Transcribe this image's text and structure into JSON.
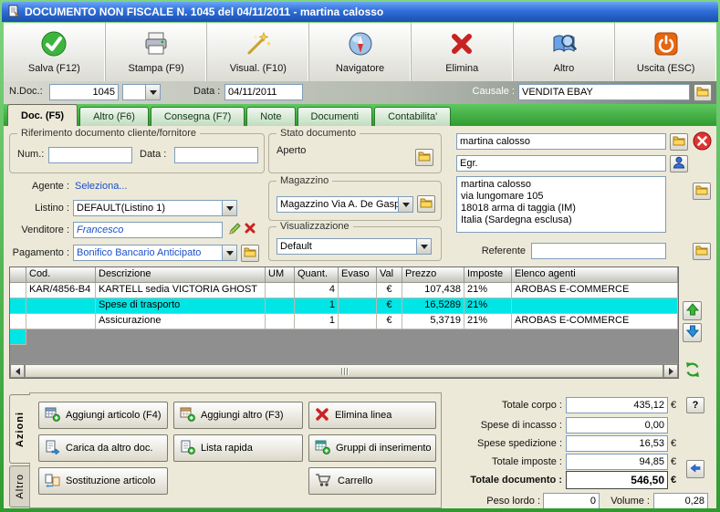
{
  "window": {
    "title": "DOCUMENTO NON FISCALE N. 1045  del 04/11/2011 - martina calosso"
  },
  "toolbar": {
    "buttons": [
      {
        "label": "Salva (F12)"
      },
      {
        "label": "Stampa (F9)"
      },
      {
        "label": "Visual. (F10)"
      },
      {
        "label": "Navigatore"
      },
      {
        "label": "Elimina"
      },
      {
        "label": "Altro"
      },
      {
        "label": "Uscita (ESC)"
      }
    ]
  },
  "header": {
    "ndoc_label": "N.Doc.:",
    "ndoc_value": "1045",
    "data_label": "Data :",
    "data_value": "04/11/2011",
    "causale_label": "Causale :",
    "causale_value": "VENDITA EBAY"
  },
  "tabs": [
    {
      "label": "Doc. (F5)"
    },
    {
      "label": "Altro (F6)"
    },
    {
      "label": "Consegna (F7)"
    },
    {
      "label": "Note"
    },
    {
      "label": "Documenti"
    },
    {
      "label": "Contabilita'"
    }
  ],
  "reference_box": {
    "legend": "Riferimento documento cliente/fornitore",
    "num_label": "Num.:",
    "num_value": "",
    "data_label": "Data :",
    "data_value": ""
  },
  "left_fields": {
    "agente_label": "Agente :",
    "agente_value": "Seleziona...",
    "listino_label": "Listino :",
    "listino_value": "DEFAULT(Listino 1)",
    "venditore_label": "Venditore :",
    "venditore_value": "Francesco",
    "pagamento_label": "Pagamento :",
    "pagamento_value": "Bonifico Bancario Anticipato"
  },
  "middle": {
    "stato_legend": "Stato documento",
    "stato_value": "Aperto",
    "magazzino_legend": "Magazzino",
    "magazzino_value": "Magazzino Via A. De Gasperi",
    "visualizzazione_legend": "Visualizzazione",
    "visualizzazione_value": "Default"
  },
  "customer": {
    "name_value": "martina calosso",
    "title_value": "Egr.",
    "address_lines": "martina calosso\nvia lungomare 105\n18018 arma di taggia (IM)\nItalia (Sardegna esclusa)",
    "referente_label": "Referente",
    "referente_value": ""
  },
  "table": {
    "headers": [
      "Cod.",
      "Descrizione",
      "UM",
      "Quant.",
      "Evaso",
      "Val",
      "Prezzo",
      "Imposte",
      "Elenco agenti"
    ],
    "rows": [
      {
        "cod": "KAR/4856-B4",
        "desc": "KARTELL sedia VICTORIA GHOST",
        "um": "",
        "quant": "4",
        "evaso": "",
        "val": "€",
        "prezzo": "107,438",
        "imposte": "21%",
        "agenti": "AROBAS E-COMMERCE"
      },
      {
        "cod": "",
        "desc": "Spese di trasporto",
        "um": "",
        "quant": "1",
        "evaso": "",
        "val": "€",
        "prezzo": "16,5289",
        "imposte": "21%",
        "agenti": ""
      },
      {
        "cod": "",
        "desc": "Assicurazione",
        "um": "",
        "quant": "1",
        "evaso": "",
        "val": "€",
        "prezzo": "5,3719",
        "imposte": "21%",
        "agenti": "AROBAS E-COMMERCE"
      }
    ]
  },
  "action_tabs": {
    "azioni": "Azioni",
    "altro": "Altro"
  },
  "action_buttons": {
    "aggiungi_articolo": "Aggiungi articolo (F4)",
    "aggiungi_altro": "Aggiungi altro (F3)",
    "elimina_linea": "Elimina linea",
    "carica_da_altro": "Carica da altro doc.",
    "lista_rapida": "Lista rapida",
    "gruppi_inserimento": "Gruppi di inserimento",
    "sostituzione_articolo": "Sostituzione articolo",
    "carrello": "Carrello"
  },
  "totals": {
    "corpo_label": "Totale corpo :",
    "corpo_value": "435,12",
    "incasso_label": "Spese di incasso :",
    "incasso_value": "0,00",
    "spedizione_label": "Spese spedizione :",
    "spedizione_value": "16,53",
    "imposte_label": "Totale imposte :",
    "imposte_value": "94,85",
    "documento_label": "Totale documento :",
    "documento_value": "546,50",
    "peso_label": "Peso lordo :",
    "peso_value": "0",
    "volume_label": "Volume :",
    "volume_value": "0,28",
    "euro": "€",
    "help": "?"
  }
}
